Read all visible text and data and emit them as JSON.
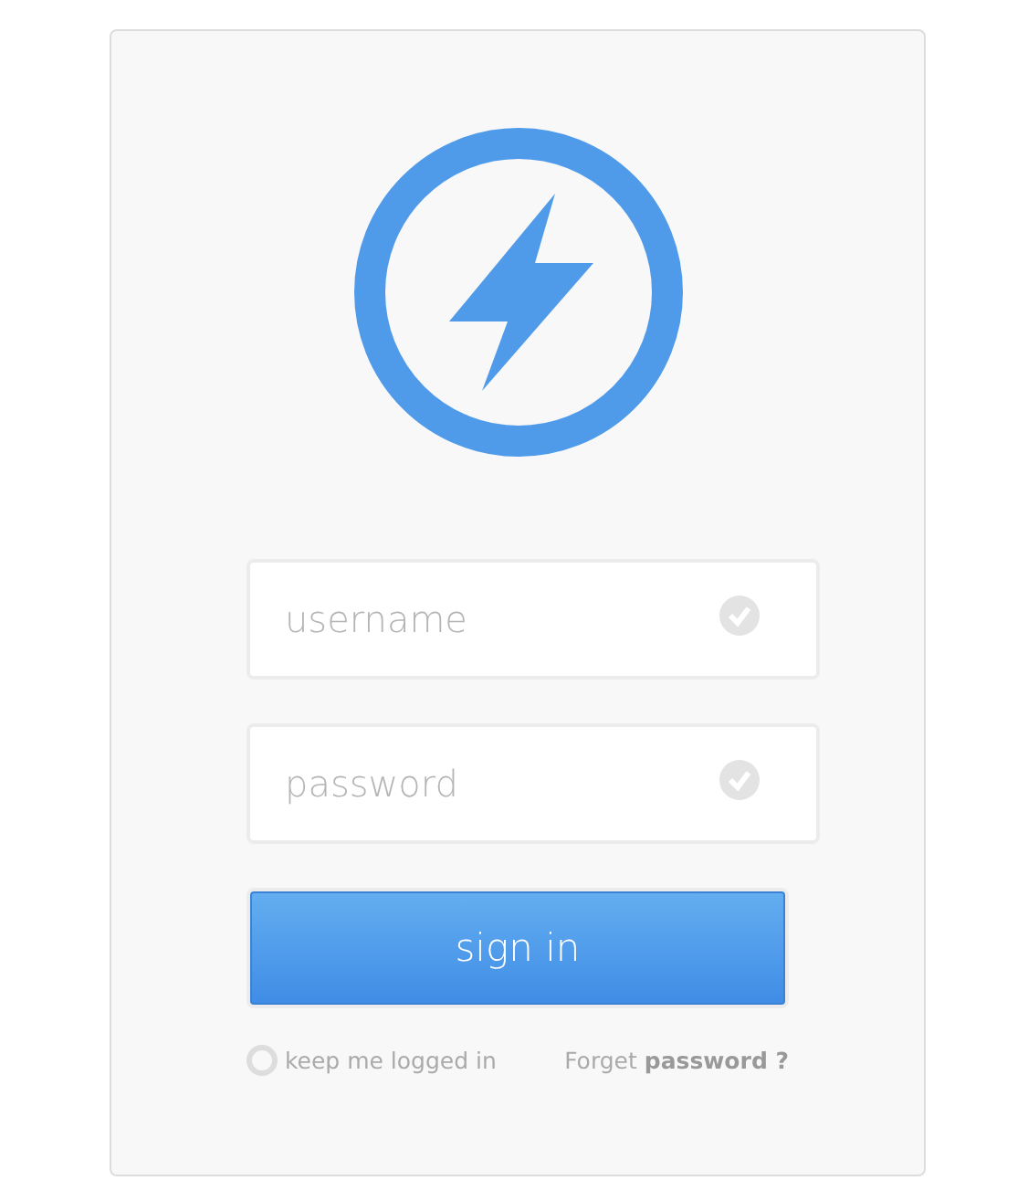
{
  "fields": [
    {
      "placeholder": "username"
    },
    {
      "placeholder": "password"
    }
  ],
  "button": "sign in",
  "remember": {
    "label": "keep me logged in",
    "checked": false
  },
  "forgot": "Forget **password ?**"
}
